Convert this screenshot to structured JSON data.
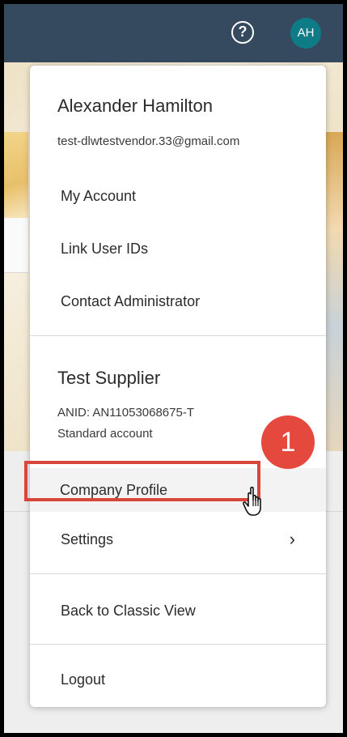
{
  "topbar": {
    "help_icon": "?",
    "avatar_initials": "AH",
    "avatar_color": "#0e7c86",
    "bar_color": "#354a5f"
  },
  "menu": {
    "user": {
      "name": "Alexander Hamilton",
      "email": "test-dlwtestvendor.33@gmail.com"
    },
    "user_items": [
      {
        "label": "My Account"
      },
      {
        "label": "Link User IDs"
      },
      {
        "label": "Contact Administrator"
      }
    ],
    "org": {
      "name": "Test Supplier",
      "anid": "ANID: AN11053068675-T",
      "account_type": "Standard account"
    },
    "org_items": [
      {
        "label": "Company Profile"
      },
      {
        "label": "Settings",
        "chevron": "›"
      }
    ],
    "back_label": "Back to Classic View",
    "logout_label": "Logout"
  },
  "annotation": {
    "step_number": "1",
    "highlight_color": "#d9463b"
  }
}
